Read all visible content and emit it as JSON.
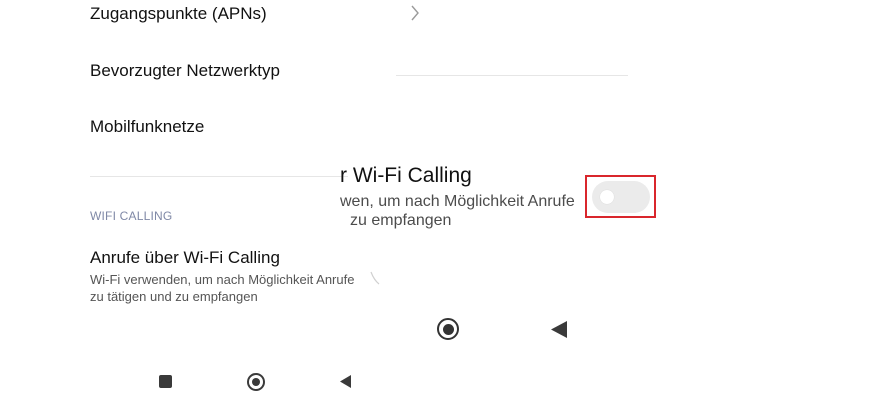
{
  "settings": {
    "apn_label": "Zugangspunkte (APNs)",
    "network_type_label": "Bevorzugter Netzwerktyp",
    "mobile_networks_label": "Mobilfunknetze",
    "wifi_section_header": "WIFI CALLING",
    "wifi_calling_title": "Anrufe über Wi-Fi Calling",
    "wifi_calling_subtitle_line1": "Wi-Fi verwenden, um nach Möglichkeit Anrufe",
    "wifi_calling_subtitle_line2": "zu tätigen und zu empfangen",
    "wifi_calling_enabled": false
  },
  "zoom_overlay": {
    "title_fragment": "r Wi-Fi Calling",
    "subtitle_line1_fragment": "wen, um nach Möglichkeit Anrufe",
    "subtitle_line2_fragment": "zu empfangen"
  },
  "icons": {
    "apn_chevron": "chevron-right-icon",
    "nav_recents": "square-icon",
    "nav_home": "circle-icon",
    "nav_back": "triangle-left-icon"
  },
  "colors": {
    "highlight": "#d9262c",
    "section_header": "#7f88a6",
    "toggle_off_track": "#ebebeb"
  }
}
